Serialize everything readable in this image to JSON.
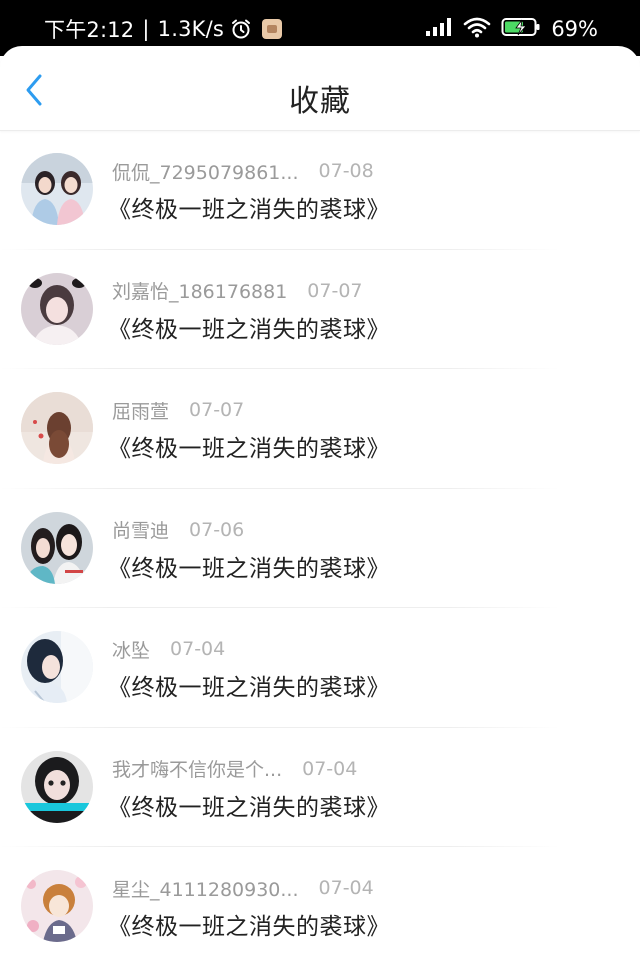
{
  "status_bar": {
    "time": "下午2:12",
    "speed": "1.3K/s",
    "battery": "69%"
  },
  "header": {
    "title": "收藏"
  },
  "items": [
    {
      "user": "侃侃_7295079861...",
      "date": "07-08",
      "title": "《终极一班之消失的裘球》"
    },
    {
      "user": "刘嘉怡_186176881",
      "date": "07-07",
      "title": "《终极一班之消失的裘球》"
    },
    {
      "user": "屈雨萱",
      "date": "07-07",
      "title": "《终极一班之消失的裘球》"
    },
    {
      "user": "尚雪迪",
      "date": "07-06",
      "title": "《终极一班之消失的裘球》"
    },
    {
      "user": "冰坠",
      "date": "07-04",
      "title": "《终极一班之消失的裘球》"
    },
    {
      "user": "我才嗨不信你是个...",
      "date": "07-04",
      "title": "《终极一班之消失的裘球》"
    },
    {
      "user": "星尘_4111280930...",
      "date": "07-04",
      "title": "《终极一班之消失的裘球》"
    }
  ],
  "colors": {
    "accent": "#2d9cf0",
    "title_text": "#222222",
    "secondary_text": "#9a9a9a"
  },
  "icons": {
    "back": "chevron-left-icon",
    "alarm": "alarm-icon",
    "signal": "signal-icon",
    "wifi": "wifi-icon",
    "battery": "battery-charging-icon"
  }
}
